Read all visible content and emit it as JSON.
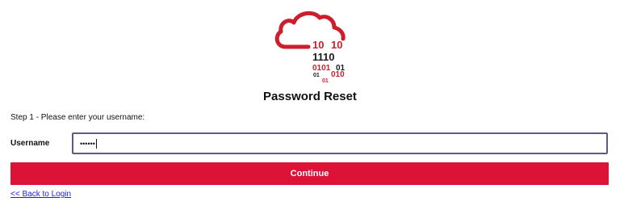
{
  "logo": {
    "icon": "cloud-binary-logo",
    "colors": {
      "red": "#cc1f2b",
      "dark": "#1a1a1a"
    },
    "binary_lines": [
      "10",
      "10",
      "1110",
      "0101",
      "01",
      "01",
      "010",
      "01"
    ]
  },
  "title": "Password Reset",
  "step_text": "Step 1 - Please enter your username:",
  "username": {
    "label": "Username",
    "value": "••••••"
  },
  "continue_button": {
    "label": "Continue",
    "color": "#dc1237"
  },
  "back_link": {
    "label": "<< Back to Login"
  }
}
